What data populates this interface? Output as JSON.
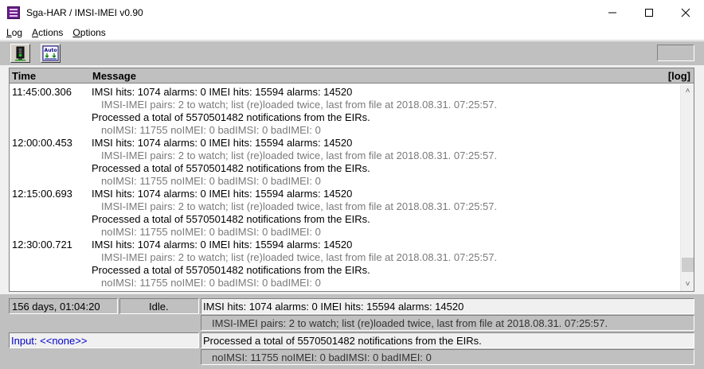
{
  "window": {
    "title": "Sga-HAR / IMSI-IMEI  v0.90"
  },
  "menu": [
    {
      "label": "Log",
      "accel": "L",
      "rest": "og"
    },
    {
      "label": "Actions",
      "accel": "A",
      "rest": "ctions"
    },
    {
      "label": "Options",
      "accel": "O",
      "rest": "ptions"
    }
  ],
  "toolbar": {
    "button1_icon": "traffic-light-icon",
    "button2_icon": "auto-download-icon",
    "button2_text": "Auto"
  },
  "log": {
    "header": {
      "time": "Time",
      "message": "Message",
      "log": "[log]"
    },
    "lines": [
      {
        "time": "11:45:00.306",
        "msg": "IMSI hits: 1074  alarms: 0   IMEI hits: 15594  alarms: 14520",
        "kind": "main"
      },
      {
        "time": "",
        "msg": "IMSI-IMEI pairs: 2 to watch;  list (re)loaded twice, last from file at 2018.08.31. 07:25:57.",
        "kind": "sub"
      },
      {
        "time": "",
        "msg": "Processed a total of 5570501482 notifications from the EIRs.",
        "kind": "main"
      },
      {
        "time": "",
        "msg": "noIMSI: 11755   noIMEI: 0   badIMSI: 0   badIMEI: 0",
        "kind": "sub"
      },
      {
        "time": "12:00:00.453",
        "msg": "IMSI hits: 1074  alarms: 0   IMEI hits: 15594  alarms: 14520",
        "kind": "main"
      },
      {
        "time": "",
        "msg": "IMSI-IMEI pairs: 2 to watch;  list (re)loaded twice, last from file at 2018.08.31. 07:25:57.",
        "kind": "sub"
      },
      {
        "time": "",
        "msg": "Processed a total of 5570501482 notifications from the EIRs.",
        "kind": "main"
      },
      {
        "time": "",
        "msg": "noIMSI: 11755   noIMEI: 0   badIMSI: 0   badIMEI: 0",
        "kind": "sub"
      },
      {
        "time": "12:15:00.693",
        "msg": "IMSI hits: 1074  alarms: 0   IMEI hits: 15594  alarms: 14520",
        "kind": "main"
      },
      {
        "time": "",
        "msg": "IMSI-IMEI pairs: 2 to watch;  list (re)loaded twice, last from file at 2018.08.31. 07:25:57.",
        "kind": "sub"
      },
      {
        "time": "",
        "msg": "Processed a total of 5570501482 notifications from the EIRs.",
        "kind": "main"
      },
      {
        "time": "",
        "msg": "noIMSI: 11755   noIMEI: 0   badIMSI: 0   badIMEI: 0",
        "kind": "sub"
      },
      {
        "time": "12:30:00.721",
        "msg": "IMSI hits: 1074  alarms: 0   IMEI hits: 15594  alarms: 14520",
        "kind": "main"
      },
      {
        "time": "",
        "msg": "IMSI-IMEI pairs: 2 to watch;  list (re)loaded twice, last from file at 2018.08.31. 07:25:57.",
        "kind": "sub"
      },
      {
        "time": "",
        "msg": "Processed a total of 5570501482 notifications from the EIRs.",
        "kind": "main"
      },
      {
        "time": "",
        "msg": "noIMSI: 11755   noIMEI: 0   badIMSI: 0   badIMEI: 0",
        "kind": "sub"
      }
    ]
  },
  "status": {
    "uptime": "156 days, 01:04:20",
    "state": "Idle.",
    "line1": "IMSI hits: 1074  alarms: 0   IMEI hits: 15594  alarms: 14520",
    "line2": "IMSI-IMEI pairs: 2 to watch;  list (re)loaded twice, last from file at 2018.08.31. 07:25:57.",
    "input": "Input: <<none>>",
    "line3": "Processed a total of 5570501482 notifications from the EIRs.",
    "line4": "noIMSI: 11755   noIMEI: 0   badIMSI: 0   badIMEI: 0"
  },
  "colors": {
    "input_text": "#0000c8",
    "app_icon": "#6a1f8a"
  }
}
